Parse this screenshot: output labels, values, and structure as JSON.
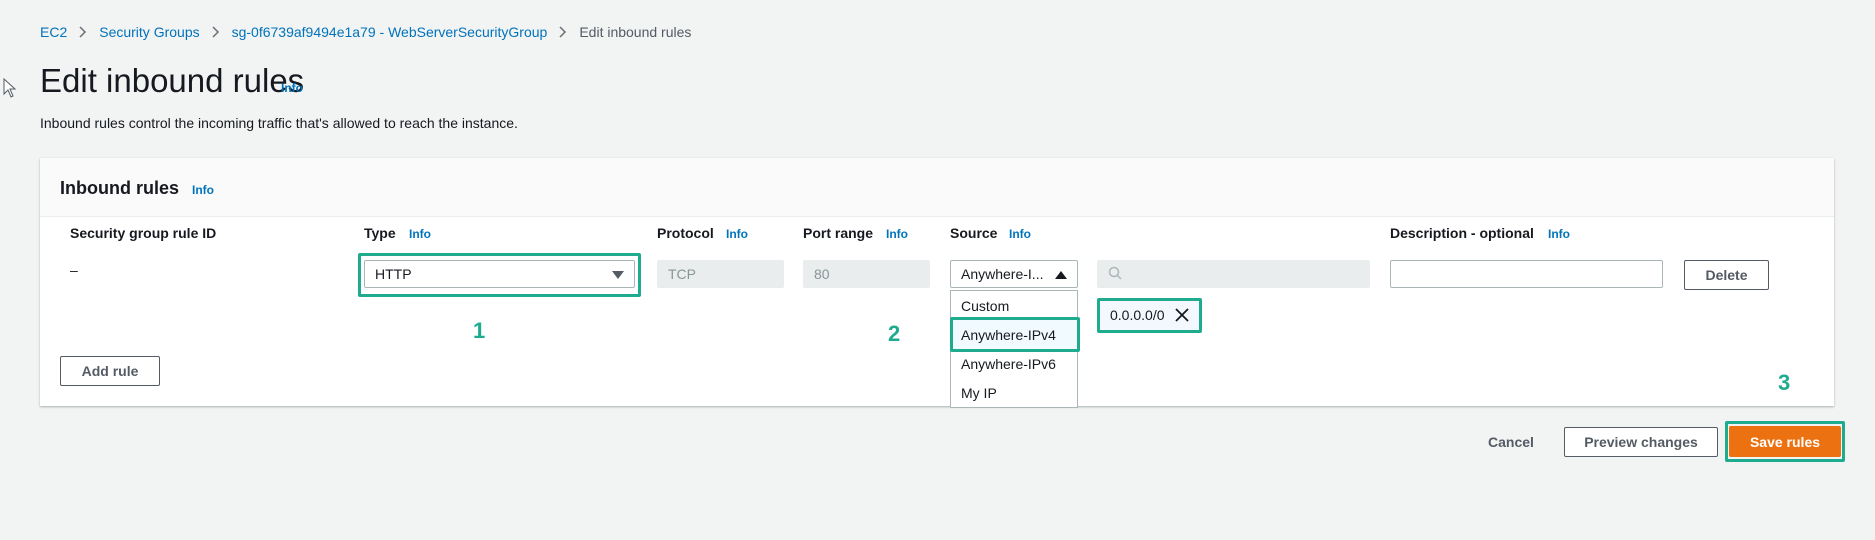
{
  "breadcrumb": {
    "items": [
      "EC2",
      "Security Groups",
      "sg-0f6739af9494e1a79 - WebServerSecurityGroup"
    ],
    "current": "Edit inbound rules"
  },
  "page": {
    "title": "Edit inbound rules",
    "info": "Info",
    "description": "Inbound rules control the incoming traffic that's allowed to reach the instance."
  },
  "panel": {
    "title": "Inbound rules",
    "info": "Info",
    "columns": {
      "rule_id": "Security group rule ID",
      "type": "Type",
      "protocol": "Protocol",
      "port_range": "Port range",
      "source": "Source",
      "description": "Description - optional"
    },
    "column_info": "Info"
  },
  "rule": {
    "id": "–",
    "type": "HTTP",
    "protocol": "TCP",
    "port_range": "80",
    "source": "Anywhere-I...",
    "cidr_token": "0.0.0.0/0",
    "description_value": "",
    "delete_label": "Delete"
  },
  "source_dropdown": {
    "options": [
      "Custom",
      "Anywhere-IPv4",
      "Anywhere-IPv6",
      "My IP"
    ],
    "highlighted": "Anywhere-IPv4"
  },
  "add_rule_label": "Add rule",
  "footer": {
    "cancel": "Cancel",
    "preview": "Preview changes",
    "save": "Save rules"
  },
  "annotations": {
    "step1": "1",
    "step2": "2",
    "step3": "3"
  },
  "colors": {
    "accent_link": "#0073bb",
    "highlight": "#1fac8e",
    "primary_button": "#ec7211"
  }
}
